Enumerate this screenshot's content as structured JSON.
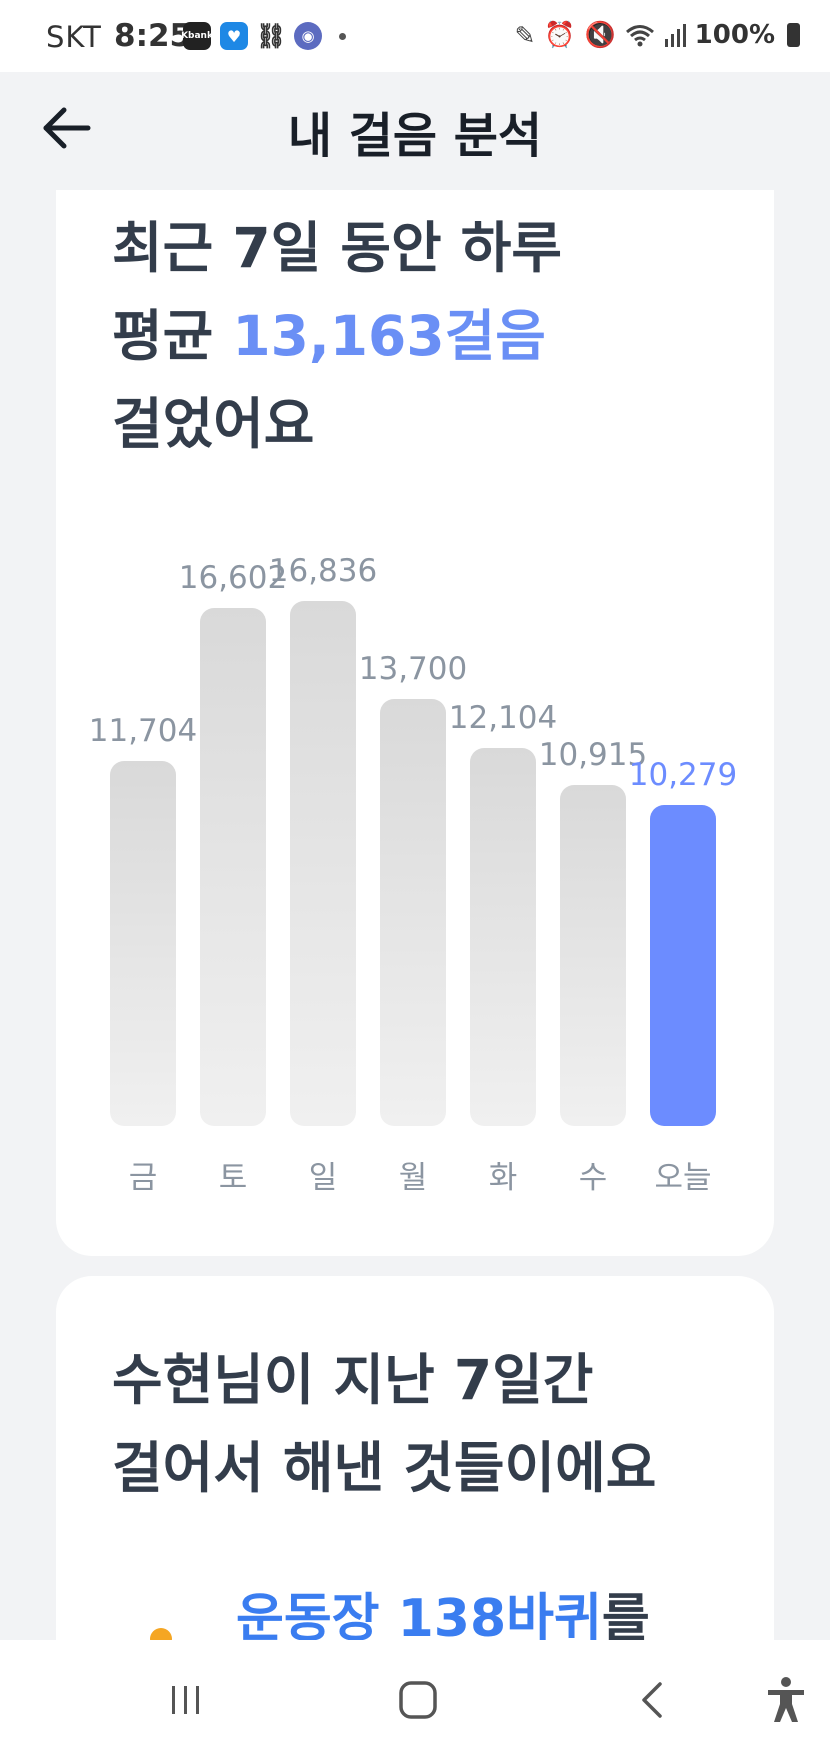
{
  "status_bar": {
    "carrier": "SKT",
    "time": "8:25",
    "apps": [
      {
        "icon": "kbank-app-icon",
        "label": "Kbank"
      },
      {
        "icon": "heart-app-icon"
      },
      {
        "icon": "link-icon"
      },
      {
        "icon": "owl-app-icon"
      }
    ],
    "battery": "100%"
  },
  "header": {
    "title": "내 걸음 분석",
    "back_icon": "arrow-left-icon"
  },
  "summary_card": {
    "line1": "최근 7일 동안 하루",
    "line2_prefix": "평균 ",
    "line2_accent": "13,163걸음",
    "line3": "걸었어요"
  },
  "chart_data": {
    "type": "bar",
    "categories": [
      "금",
      "토",
      "일",
      "월",
      "화",
      "수",
      "오늘"
    ],
    "values": [
      11704,
      16602,
      16836,
      13700,
      12104,
      10915,
      10279
    ],
    "value_labels": [
      "11,704",
      "16,602",
      "16,836",
      "13,700",
      "12,104",
      "10,915",
      "10,279"
    ],
    "highlight_index": 6,
    "colors": {
      "bar": "#dcdcdc",
      "highlight": "#6c8cff",
      "label": "#8b95a1"
    }
  },
  "achievement_card": {
    "line1": "수현님이 지난 7일간",
    "line2": "걸어서 해낸 것들이에요",
    "item_accent": "운동장 138바퀴",
    "item_suffix": "를"
  },
  "colors": {
    "accent": "#6a8ff5",
    "achievement_accent": "#3a7df0",
    "background": "#f2f3f5"
  }
}
